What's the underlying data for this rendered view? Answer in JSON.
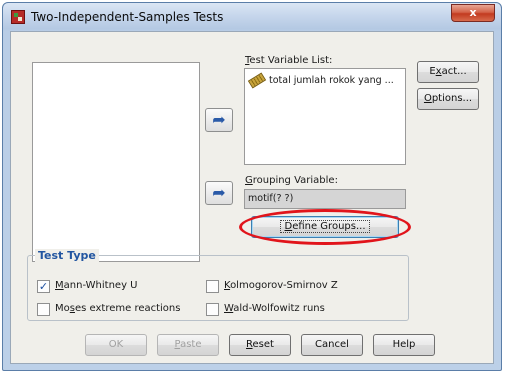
{
  "window": {
    "title": "Two-Independent-Samples Tests",
    "close_glyph": "x",
    "app_icon": "spss-dialog-icon"
  },
  "arrows": {
    "glyph": "➦",
    "icon": "move-right-arrow-icon"
  },
  "test_variable": {
    "label_first": "T",
    "label_rest": "est Variable List:",
    "items": [
      {
        "icon": "scale-ruler-icon",
        "text": "total jumlah rokok yang ..."
      }
    ]
  },
  "grouping": {
    "label_first": "G",
    "label_rest": "rouping Variable:",
    "value": "motif(? ?)",
    "define_groups_first": "D",
    "define_groups_rest": "efine Groups..."
  },
  "side_buttons": {
    "exact_pre": "E",
    "exact_u": "x",
    "exact_post": "act...",
    "options_u": "O",
    "options_post": "ptions..."
  },
  "test_type": {
    "title": "Test Type",
    "mann_whitney": {
      "u": "M",
      "rest": "ann-Whitney U",
      "checked": true
    },
    "kolmogorov": {
      "u": "K",
      "rest": "olmogorov-Smirnov Z",
      "checked": false
    },
    "moses": {
      "pre": "Mo",
      "u": "s",
      "post": "es extreme reactions",
      "checked": false
    },
    "wald": {
      "u": "W",
      "rest": "ald-Wolfowitz runs",
      "checked": false
    }
  },
  "footer": {
    "ok": "OK",
    "paste_u": "P",
    "paste_rest": "aste",
    "reset_u": "R",
    "reset_rest": "eset",
    "cancel": "Cancel",
    "help": "Help"
  },
  "colors": {
    "accent_blue": "#2255a0",
    "annotation_red": "#e1141b",
    "close_red": "#c23b20"
  }
}
